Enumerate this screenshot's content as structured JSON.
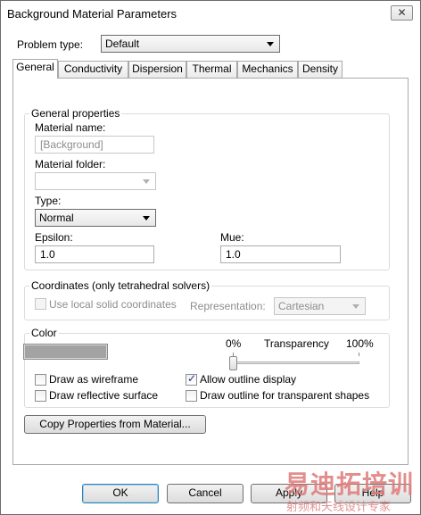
{
  "window": {
    "title": "Background Material Parameters",
    "close_glyph": "✕"
  },
  "problem_type": {
    "label": "Problem type:",
    "value": "Default"
  },
  "tabs": [
    {
      "label": "General"
    },
    {
      "label": "Conductivity"
    },
    {
      "label": "Dispersion"
    },
    {
      "label": "Thermal"
    },
    {
      "label": "Mechanics"
    },
    {
      "label": "Density"
    }
  ],
  "general": {
    "group_label": "General properties",
    "material_name_label": "Material name:",
    "material_name_value": "[Background]",
    "material_folder_label": "Material folder:",
    "material_folder_value": "",
    "type_label": "Type:",
    "type_value": "Normal",
    "epsilon_label": "Epsilon:",
    "epsilon_value": "1.0",
    "mue_label": "Mue:",
    "mue_value": "1.0"
  },
  "coordinates": {
    "group_label": "Coordinates (only tetrahedral solvers)",
    "use_local_label": "Use local solid coordinates",
    "use_local_checked": false,
    "representation_label": "Representation:",
    "representation_value": "Cartesian"
  },
  "color": {
    "group_label": "Color",
    "swatch_color": "#a3a3a3",
    "transparency_min": "0%",
    "transparency_label": "Transparency",
    "transparency_max": "100%",
    "transparency_value": 0,
    "draw_wireframe_label": "Draw as wireframe",
    "draw_wireframe_checked": false,
    "allow_outline_label": "Allow outline display",
    "allow_outline_checked": true,
    "draw_reflective_label": "Draw reflective surface",
    "draw_reflective_checked": false,
    "draw_outline_transparent_label": "Draw outline for transparent shapes",
    "draw_outline_transparent_checked": false
  },
  "copy_button": "Copy Properties from Material...",
  "footer": {
    "ok": "OK",
    "cancel": "Cancel",
    "apply": "Apply",
    "help": "Help"
  },
  "watermark": {
    "main": "易迪拓培训",
    "sub": "射频和天线设计专家"
  }
}
